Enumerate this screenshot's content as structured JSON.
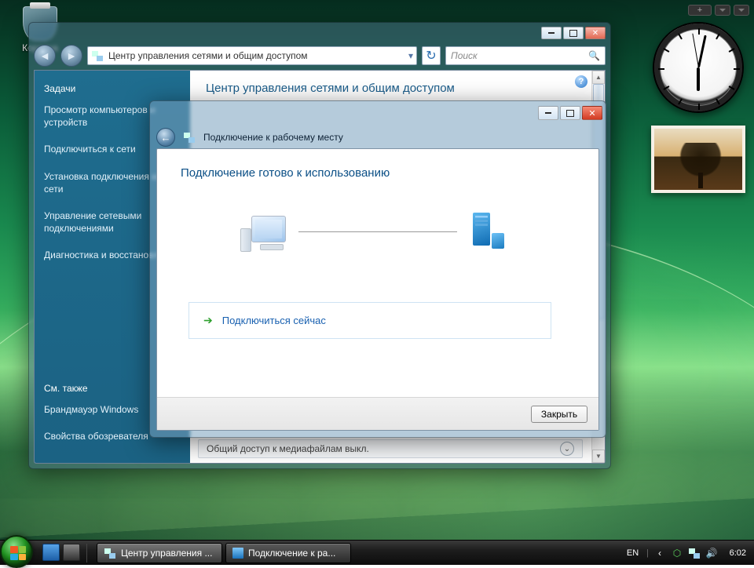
{
  "desktop": {
    "recycle_bin_label": "Корзина"
  },
  "network_window": {
    "titlebar": {
      "min": "",
      "max": "",
      "close": ""
    },
    "address": "Центр управления сетями и общим доступом",
    "search_placeholder": "Поиск",
    "content_title": "Центр управления сетями и общим доступом",
    "sidebar": {
      "heading": "Задачи",
      "items": [
        "Просмотр компьютеров и устройств",
        "Подключиться к сети",
        "Установка подключения или сети",
        "Управление сетевыми подключениями",
        "Диагностика и восстановление"
      ],
      "see_also_heading": "См. также",
      "see_also": [
        "Брандмауэр Windows",
        "Свойства обозревателя"
      ]
    },
    "media_row": "Общий доступ к медиафайлам   выкл."
  },
  "wizard": {
    "title": "Подключение к рабочему месту",
    "heading": "Подключение готово к использованию",
    "connect_now": "Подключиться сейчас",
    "close_button": "Закрыть"
  },
  "taskbar": {
    "task1": "Центр управления ...",
    "task2": "Подключение к ра...",
    "lang": "EN",
    "time": "6:02"
  },
  "gadget_clock": {
    "hour_deg": 180,
    "minute_deg": 12,
    "second_deg": 350
  }
}
